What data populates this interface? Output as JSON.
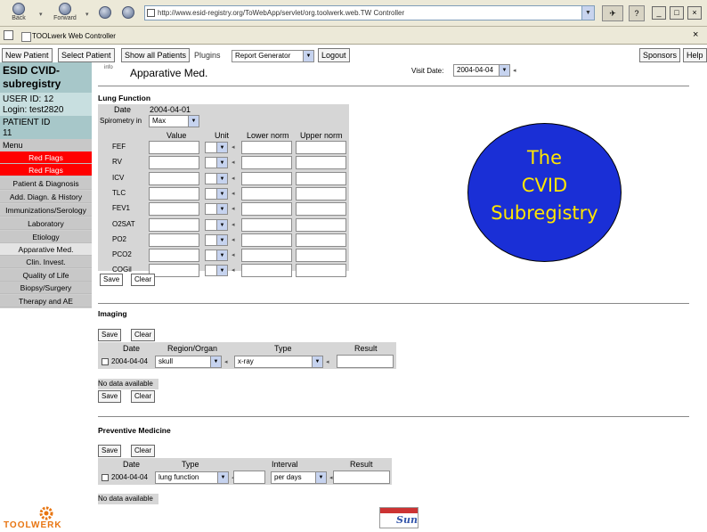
{
  "browser": {
    "back_label": "Back",
    "forward_label": "Forward",
    "address": "http://www.esid-registry.org/ToWebApp/servlet/org.toolwerk.web.TW Controller",
    "tab_title": "TOOLwerk Web Controller"
  },
  "header": {
    "buttons": [
      "New Patient",
      "Select Patient",
      "Show all Patients"
    ],
    "plugins_label": "Plugins",
    "plugin_select": "Report Generator",
    "logout": "Logout",
    "sponsors": "Sponsors",
    "help": "Help"
  },
  "sidebar": {
    "title_line1": "ESID CVID-",
    "title_line2": "subregistry",
    "user_id": "USER ID: 12",
    "login": "Login: test2820",
    "patient_id_label": "PATIENT ID",
    "patient_id": "11",
    "menu_label": "Menu",
    "items": [
      {
        "label": "Red Flags",
        "style": "red"
      },
      {
        "label": "Red Flags",
        "style": "red"
      },
      {
        "label": "Patient & Diagnosis",
        "style": "normal"
      },
      {
        "label": "Add. Diagn. & History",
        "style": "normal"
      },
      {
        "label": "Immunizations/Serology",
        "style": "normal"
      },
      {
        "label": "Laboratory",
        "style": "normal"
      },
      {
        "label": "Etiology",
        "style": "normal"
      },
      {
        "label": "Apparative Med.",
        "style": "selected"
      },
      {
        "label": "Clin. Invest.",
        "style": "normal"
      },
      {
        "label": "Quality of Life",
        "style": "normal"
      },
      {
        "label": "Biopsy/Surgery",
        "style": "normal"
      },
      {
        "label": "Therapy and AE",
        "style": "normal"
      }
    ]
  },
  "page": {
    "icon_text": "info",
    "title": "Apparative Med.",
    "visit_date_label": "Visit Date:",
    "visit_date": "2004-04-04"
  },
  "lung": {
    "section_title": "Lung Function",
    "date_label": "Date",
    "date_value": "2004-04-01",
    "spirometry_label": "Spirometry in",
    "spirometry_value": "Max",
    "columns": [
      "Value",
      "Unit",
      "Lower norm",
      "Upper norm"
    ],
    "rows": [
      "FEF",
      "RV",
      "ICV",
      "TLC",
      "FEV1",
      "O2SAT",
      "PO2",
      "PCO2",
      "COGil"
    ],
    "save": "Save",
    "clear": "Clear"
  },
  "logo": {
    "line1": "The",
    "line2": "CVID",
    "line3": "Subregistry",
    "color_bg": "#1a2fd6",
    "color_text": "#ffe600"
  },
  "imaging": {
    "section_title": "Imaging",
    "save": "Save",
    "clear": "Clear",
    "columns": [
      "Date",
      "Region/Organ",
      "Type",
      "Result"
    ],
    "row_date": "2004-04-04",
    "row_region": "skull",
    "row_type": "x-ray",
    "no_data": "No data available",
    "save2": "Save",
    "clear2": "Clear"
  },
  "preventive": {
    "section_title": "Preventive Medicine",
    "save": "Save",
    "clear": "Clear",
    "columns": [
      "Date",
      "Type",
      "Interval",
      "Result"
    ],
    "row_date": "2004-04-04",
    "row_type": "lung function",
    "row_interval": "per days",
    "no_data": "No data available"
  },
  "footer": {
    "toolwerk": "TOOLWERK",
    "sun_text": "Sun"
  }
}
